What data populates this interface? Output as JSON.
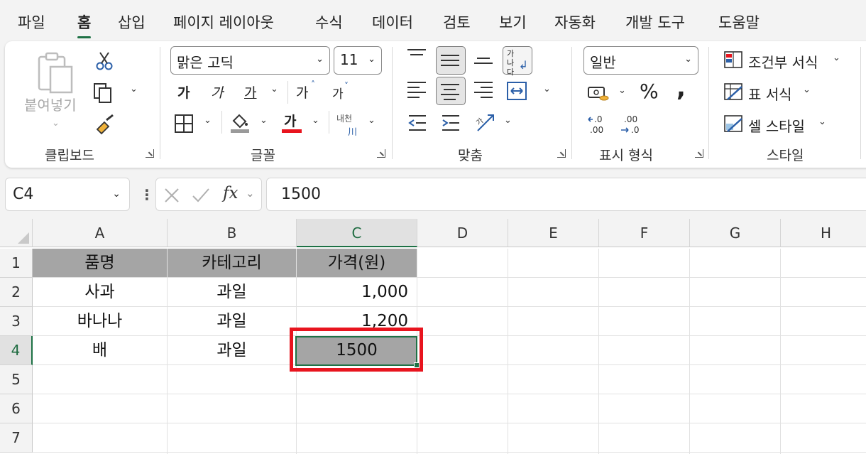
{
  "menu": {
    "tabs": [
      "파일",
      "홈",
      "삽입",
      "페이지 레이아웃",
      "수식",
      "데이터",
      "검토",
      "보기",
      "자동화",
      "개발 도구",
      "도움말"
    ],
    "active_index": 1
  },
  "ribbon": {
    "clipboard": {
      "label": "클립보드",
      "paste_label": "붙여넣기"
    },
    "font": {
      "label": "글꼴",
      "font_name": "맑은 고딕",
      "font_size": "11",
      "bold": "가",
      "italic": "가",
      "underline": "가",
      "grow": "가",
      "shrink": "가",
      "color_glyph": "가",
      "phonetic_top": "내천",
      "phonetic_bottom": "川"
    },
    "alignment": {
      "label": "맞춤",
      "wrap_glyph": "가나다"
    },
    "number": {
      "label": "표시 형식",
      "format": "일반",
      "percent": "%",
      "comma": ","
    },
    "styles": {
      "label": "스타일",
      "conditional": "조건부 서식",
      "table": "표 서식",
      "cell": "셀 스타일"
    }
  },
  "formula_bar": {
    "name_box": "C4",
    "value": "1500"
  },
  "sheet": {
    "columns": [
      "A",
      "B",
      "C",
      "D",
      "E",
      "F",
      "G",
      "H"
    ],
    "selected_column": "C",
    "rows": [
      "1",
      "2",
      "3",
      "4",
      "5",
      "6",
      "7"
    ],
    "selected_row": "4",
    "header": [
      "품명",
      "카테고리",
      "가격(원)"
    ],
    "data": [
      [
        "사과",
        "과일",
        "1,000"
      ],
      [
        "바나나",
        "과일",
        "1,200"
      ],
      [
        "배",
        "과일",
        "1500"
      ]
    ]
  },
  "colors": {
    "accent": "#1e7145",
    "header_fill": "#a5a5a5",
    "highlight": "#e8141e",
    "font_color_bar": "#e8141e"
  }
}
